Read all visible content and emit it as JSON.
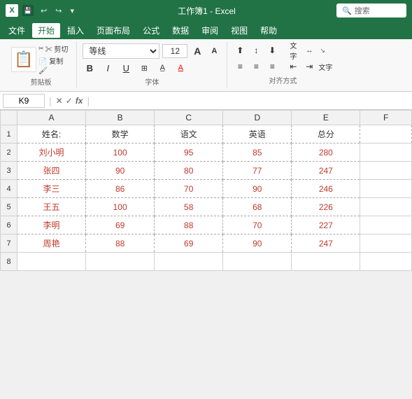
{
  "titleBar": {
    "logo": "X",
    "title": "工作簿1 - Excel",
    "searchPlaceholder": "搜索",
    "undoBtn": "↩",
    "redoBtn": "↪",
    "saveBtn": "💾"
  },
  "menuBar": {
    "items": [
      "文件",
      "开始",
      "插入",
      "页面布局",
      "公式",
      "数据",
      "审阅",
      "视图",
      "帮助"
    ],
    "active": "开始"
  },
  "ribbon": {
    "clipboard": {
      "label": "剪贴板",
      "pasteLabel": "粘贴",
      "cutLabel": "✂",
      "copyLabel": "📋",
      "formatLabel": "🖌"
    },
    "font": {
      "label": "字体",
      "name": "等线",
      "size": "12",
      "bold": "B",
      "italic": "I",
      "underline": "U"
    },
    "alignment": {
      "label": "对齐方式"
    }
  },
  "formulaBar": {
    "cellRef": "K9",
    "checkMark": "✓",
    "crossMark": "✕",
    "fx": "fx"
  },
  "spreadsheet": {
    "colHeaders": [
      "A",
      "B",
      "C",
      "D",
      "E",
      "F"
    ],
    "rows": [
      {
        "rowNum": "1",
        "cells": [
          "姓名:",
          "数学",
          "语文",
          "英语",
          "总分",
          ""
        ]
      },
      {
        "rowNum": "2",
        "cells": [
          "刘小明",
          "100",
          "95",
          "85",
          "280",
          ""
        ]
      },
      {
        "rowNum": "3",
        "cells": [
          "张四",
          "90",
          "80",
          "77",
          "247",
          ""
        ]
      },
      {
        "rowNum": "4",
        "cells": [
          "李三",
          "86",
          "70",
          "90",
          "246",
          ""
        ]
      },
      {
        "rowNum": "5",
        "cells": [
          "王五",
          "100",
          "58",
          "68",
          "226",
          ""
        ]
      },
      {
        "rowNum": "6",
        "cells": [
          "李明",
          "69",
          "88",
          "70",
          "227",
          ""
        ]
      },
      {
        "rowNum": "7",
        "cells": [
          "周艳",
          "88",
          "69",
          "90",
          "247",
          ""
        ]
      },
      {
        "rowNum": "8",
        "cells": [
          "",
          "",
          "",
          "",
          "",
          ""
        ]
      }
    ]
  }
}
